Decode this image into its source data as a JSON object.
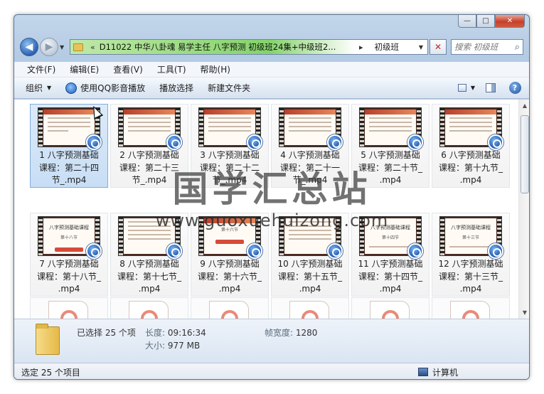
{
  "window": {
    "caption_min": "—",
    "caption_max": "□",
    "caption_close": "✕"
  },
  "nav": {
    "back_glyph": "◀",
    "forward_glyph": "▶",
    "dropdown_glyph": "▼"
  },
  "address": {
    "chevron": "«",
    "path": "D11022 中华八卦魂 易学主任 八字预测 初级班24集+中级班2...",
    "separator": "▸",
    "leaf": "初级班",
    "dropdown_glyph": "▼",
    "refresh_glyph": "✕"
  },
  "search": {
    "placeholder": "搜索 初级班",
    "icon": "search-icon"
  },
  "menu": {
    "items": [
      "文件(F)",
      "编辑(E)",
      "查看(V)",
      "工具(T)",
      "帮助(H)"
    ]
  },
  "toolbar": {
    "organize": "组织",
    "play_qq": "使用QQ影音播放",
    "play_selection": "播放选择",
    "new_folder": "新建文件夹",
    "help_glyph": "?"
  },
  "files": [
    {
      "name": "1 八字预测基础课程：第二十四节_.mp4",
      "line1": "1 八字预测基础",
      "line2": "课程：第二十四",
      "line3": "节_.mp4",
      "selected": true
    },
    {
      "name": "2 八字预测基础课程：第二十三节_.mp4",
      "line1": "2 八字预测基础",
      "line2": "课程：第二十三",
      "line3": "节_.mp4"
    },
    {
      "name": "3 八字预测基础课程：第二十二节_.mp4",
      "line1": "3 八字预测基础",
      "line2": "课程：第二十二",
      "line3": "节_.mp4"
    },
    {
      "name": "4 八字预测基础课程：第二十一节_.mp4",
      "line1": "4 八字预测基础",
      "line2": "课程：第二十一",
      "line3": "节_.mp4"
    },
    {
      "name": "5 八字预测基础课程：第二十节_.mp4",
      "line1": "5 八字预测基础",
      "line2": "课程：第二十节_",
      "line3": ".mp4"
    },
    {
      "name": "6 八字预测基础课程：第十九节_.mp4",
      "line1": "6 八字预测基础",
      "line2": "课程：第十九节_",
      "line3": ".mp4"
    },
    {
      "name": "7 八字预测基础课程：第十八节_.mp4",
      "line1": "7 八字预测基础",
      "line2": "课程：第十八节_",
      "line3": ".mp4"
    },
    {
      "name": "8 八字预测基础课程：第十七节_.mp4",
      "line1": "8 八字预测基础",
      "line2": "课程：第十七节_",
      "line3": ".mp4"
    },
    {
      "name": "9 八字预测基础课程：第十六节_.mp4",
      "line1": "9 八字预测基础",
      "line2": "课程：第十六节_",
      "line3": ".mp4"
    },
    {
      "name": "10 八字预测基础课程：第十五节_.mp4",
      "line1": "10 八字预测基础",
      "line2": "课程：第十五节_",
      "line3": ".mp4"
    },
    {
      "name": "11 八字预测基础课程：第十四节_.mp4",
      "line1": "11 八字预测基础",
      "line2": "课程：第十四节_",
      "line3": ".mp4"
    },
    {
      "name": "12 八字预测基础课程：第十三节_.mp4",
      "line1": "12 八字预测基础",
      "line2": "课程：第十三节_",
      "line3": ".mp4"
    }
  ],
  "thumbs": {
    "slide_title_a": "八字预测基础课程",
    "slide_sub_a": "第十八节",
    "slide_sub_b": "第十六节",
    "slide_sub_c": "第十四节",
    "slide_sub_d": "第十三节"
  },
  "details": {
    "selected": "已选择 25 个项",
    "length_label": "长度:",
    "length_value": "09:16:34",
    "framewidth_label": "帧宽度:",
    "framewidth_value": "1280",
    "size_label": "大小:",
    "size_value": "977 MB"
  },
  "status": {
    "left": "选定 25 个项目",
    "right": "计算机"
  },
  "watermark": {
    "line1": "国学汇总站",
    "line2": "www.guoxuehuizong.com"
  },
  "scroll": {
    "up": "▲",
    "down": "▼"
  }
}
